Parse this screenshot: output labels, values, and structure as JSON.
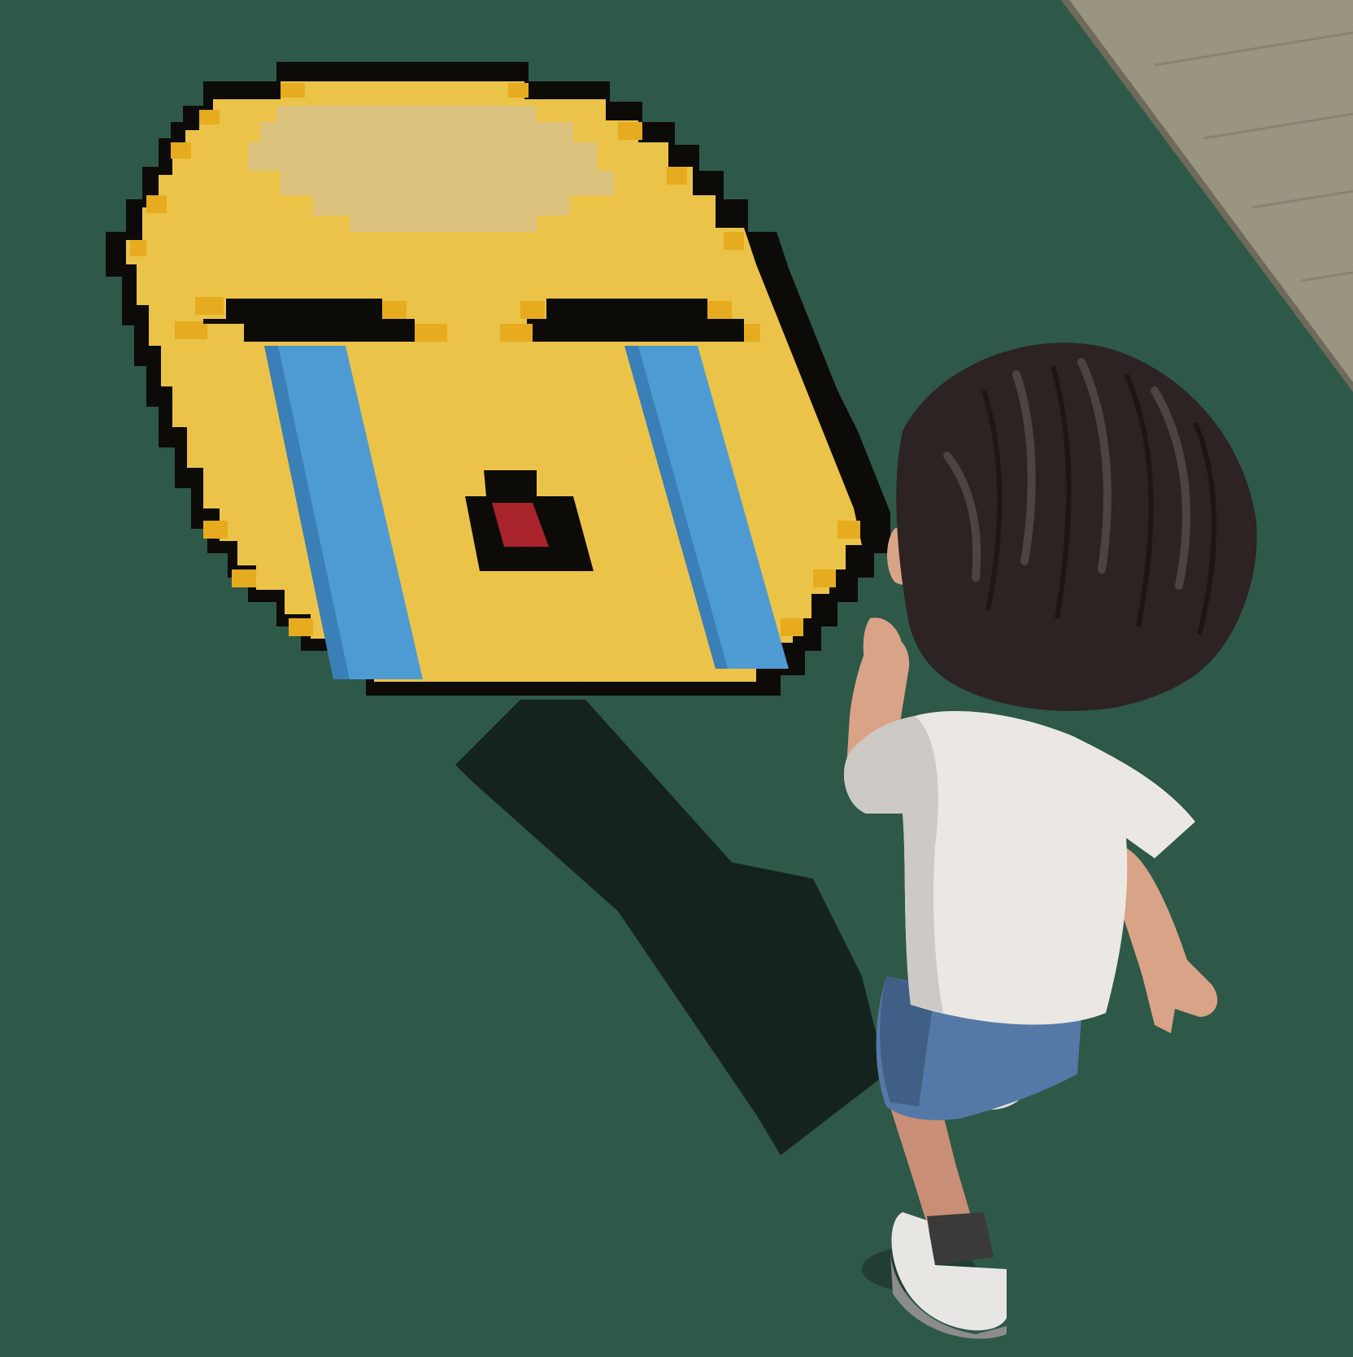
{
  "scene": {
    "description_free": true,
    "colors": {
      "ground": "#2e5848",
      "ground_shade": "#284e40",
      "sidewalk": "#9a9580",
      "sidewalk_line": "#7d7866",
      "emoji_outline": "#0d0b08",
      "emoji_face": "#ecc349",
      "emoji_rim": "#e6ab1f",
      "emoji_highlight": "#dbc27e",
      "tear": "#4e9bd4",
      "mouth_inner": "#a8232a",
      "shadow": "#111a18",
      "hair": "#2c2322",
      "skin": "#d9a387",
      "shirt": "#ebe8e4",
      "shorts": "#5579a6",
      "sock": "#3b3a3a",
      "shoe": "#e8e6e3"
    },
    "objects": {
      "floor_emoji": "crying-face-emoji",
      "character": "avatar-player"
    }
  }
}
